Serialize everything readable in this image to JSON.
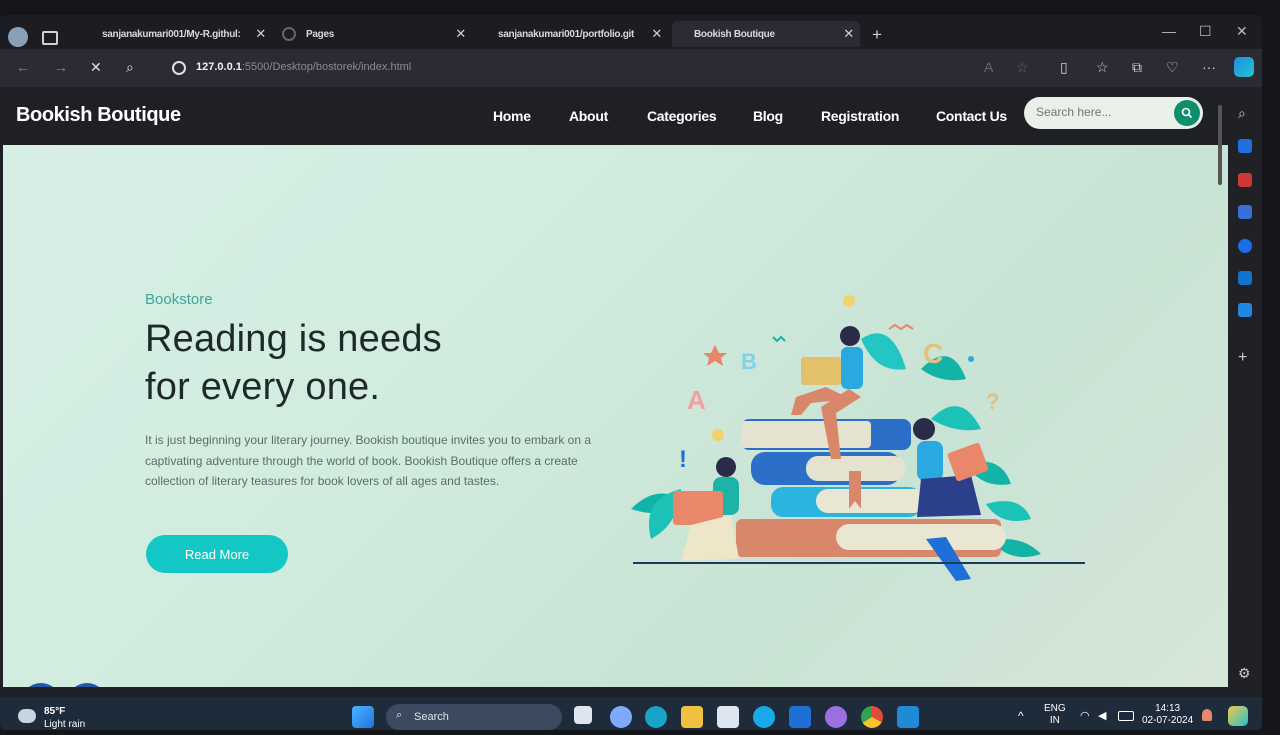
{
  "browser": {
    "tabs": [
      {
        "label": "sanjanakumari001/My-R.githul:"
      },
      {
        "label": "Pages"
      },
      {
        "label": "sanjanakumari001/portfolio.git"
      },
      {
        "label": "Bookish Boutique"
      }
    ],
    "url_host": "127.0.0.1",
    "url_rest": ":5500/Desktop/bostorek/index.html"
  },
  "site": {
    "logo": "Bookish Boutique",
    "nav": [
      "Home",
      "About",
      "Categories",
      "Blog",
      "Registration",
      "Contact Us"
    ],
    "search_placeholder": "Search here..."
  },
  "hero": {
    "eyebrow": "Bookstore",
    "title_line1": "Reading is needs",
    "title_line2": "for every one.",
    "description": "It is just beginning your literary journey. Bookish boutique invites you to embark on a captivating adventure through the world of book. Bookish Boutique offers a create collection of literary teasures for book lovers of all ages and tastes.",
    "cta": "Read More"
  },
  "illustration_letters": [
    "A",
    "B",
    "C",
    "?",
    "!"
  ],
  "taskbar": {
    "weather_temp": "85°F",
    "weather_desc": "Light rain",
    "search_label": "Search",
    "lang_top": "ENG",
    "lang_bottom": "IN",
    "time": "14:13",
    "date": "02-07-2024"
  },
  "colors": {
    "accent": "#13c7c4",
    "nav_bg": "#1f2026",
    "search_btn": "#0f8e6e"
  }
}
